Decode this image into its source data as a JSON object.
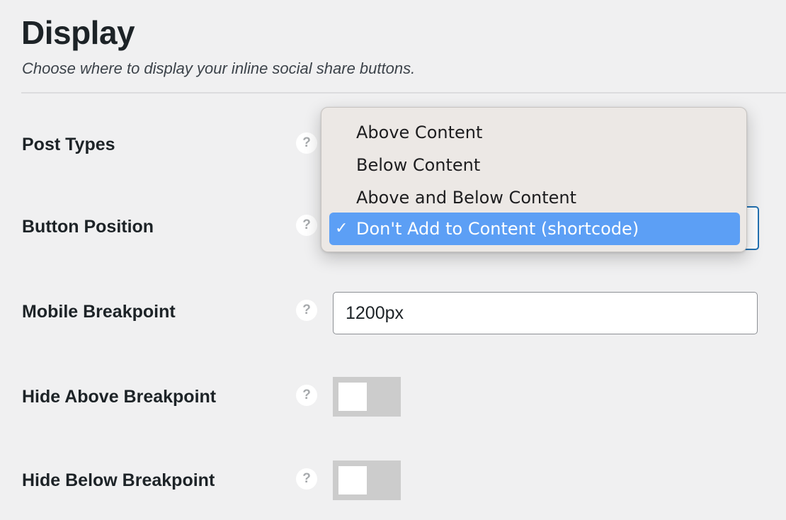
{
  "section": {
    "title": "Display",
    "description": "Choose where to display your inline social share buttons."
  },
  "rows": {
    "post_types": {
      "label": "Post Types",
      "help": "?"
    },
    "button_position": {
      "label": "Button Position",
      "help": "?",
      "selected_value": "Don't Add to Content (shortcode)",
      "options": [
        {
          "label": "Above Content",
          "checked": false,
          "check_mark": ""
        },
        {
          "label": "Below Content",
          "checked": false,
          "check_mark": ""
        },
        {
          "label": "Above and Below Content",
          "checked": false,
          "check_mark": ""
        },
        {
          "label": "Don't Add to Content (shortcode)",
          "checked": true,
          "check_mark": "✓"
        }
      ]
    },
    "mobile_breakpoint": {
      "label": "Mobile Breakpoint",
      "help": "?",
      "value": "1200px"
    },
    "hide_above_breakpoint": {
      "label": "Hide Above Breakpoint",
      "help": "?",
      "enabled": false
    },
    "hide_below_breakpoint": {
      "label": "Hide Below Breakpoint",
      "help": "?",
      "enabled": false
    }
  },
  "colors": {
    "background": "#f0f0f1",
    "accent": "#2271b1",
    "menu_highlight": "#5c9ff5",
    "toggle_off": "#cccccc"
  }
}
